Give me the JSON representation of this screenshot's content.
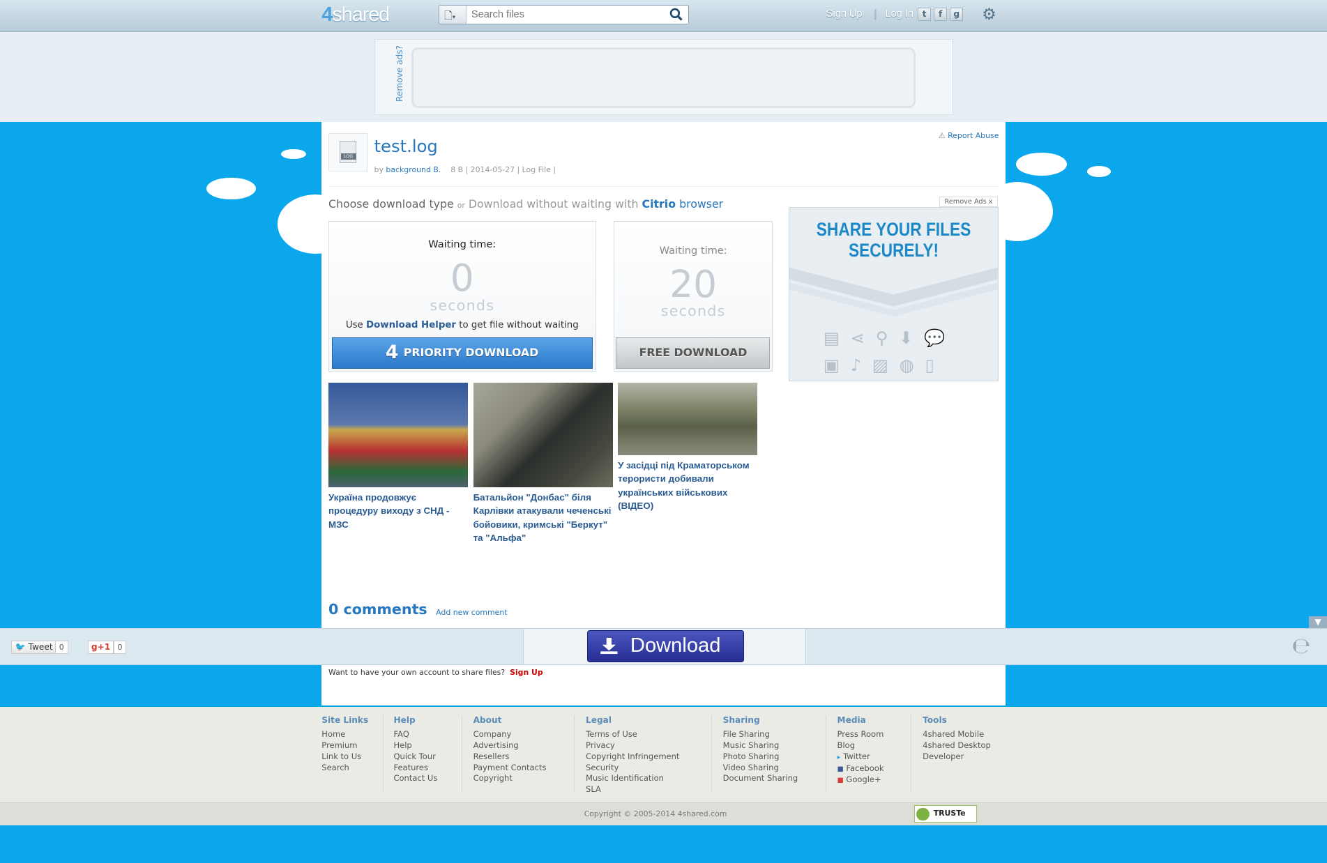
{
  "header": {
    "logo_num": "4",
    "logo_text": "shared",
    "search_placeholder": "Search files",
    "signup": "Sign Up",
    "login": "Log In"
  },
  "ad": {
    "remove_ads_vertical": "Remove ads?"
  },
  "file": {
    "title": "test.log",
    "icon_label": "LOG",
    "by": "by",
    "author": "background B.",
    "meta": "8 B | 2014-05-27 | Log File |",
    "report": "Report Abuse"
  },
  "choose": {
    "type": "Choose download type",
    "or": "or",
    "without": "Download without waiting with",
    "citrio": "Citrio",
    "browser": "browser"
  },
  "priority": {
    "waiting": "Waiting time:",
    "seconds_value": "0",
    "seconds": "seconds",
    "helper_pre": "Use",
    "helper_link": "Download Helper",
    "helper_post": "to get file without waiting",
    "button": "PRIORITY DOWNLOAD"
  },
  "free": {
    "waiting": "Waiting time:",
    "seconds_value": "20",
    "seconds": "seconds",
    "button": "FREE DOWNLOAD"
  },
  "side_ad": {
    "remove": "Remove Ads",
    "remove_x": "x",
    "headline1": "SHARE YOUR FILES",
    "headline2": "SECURELY!"
  },
  "news": [
    {
      "caption": "Україна продовжує процедуру виходу з СНД - МЗС"
    },
    {
      "caption": "Батальйон \"Донбас\" біля Карлівки атакували чеченські бойовики, кримські \"Беркут\" та \"Альфа\""
    },
    {
      "caption": "У засідці під Краматорськом терористи добивали українських військових (ВІДЕО)"
    }
  ],
  "comments": {
    "count_label": "0 comments",
    "add": "Add new comment"
  },
  "bottom": {
    "tweet": "Tweet",
    "tweet_count": "0",
    "gplus": "+1",
    "gplus_count": "0",
    "download": "Download"
  },
  "signup_line": {
    "text": "Want to have your own account to share files?",
    "link": "Sign Up"
  },
  "footer": {
    "columns": [
      {
        "title": "Site Links",
        "items": [
          "Home",
          "Premium",
          "Link to Us",
          "Search"
        ]
      },
      {
        "title": "Help",
        "items": [
          "FAQ",
          "Help",
          "Quick Tour",
          "Features",
          "Contact Us"
        ]
      },
      {
        "title": "About",
        "items": [
          "Company",
          "Advertising",
          "Resellers",
          "Payment Contacts",
          "Copyright"
        ]
      },
      {
        "title": "Legal",
        "items": [
          "Terms of Use",
          "Privacy",
          "Copyright Infringement",
          "Security",
          "Music Identification",
          "SLA"
        ]
      },
      {
        "title": "Sharing",
        "items": [
          "File Sharing",
          "Music Sharing",
          "Photo Sharing",
          "Video Sharing",
          "Document Sharing"
        ]
      },
      {
        "title": "Media",
        "items": [
          "Press Room",
          "Blog",
          "Twitter",
          "Facebook",
          "Google+"
        ]
      },
      {
        "title": "Tools",
        "items": [
          "4shared Mobile",
          "4shared Desktop",
          "Developer"
        ]
      }
    ],
    "copyright": "Copyright © 2005-2014 4shared.com",
    "truste": "TRUSTe"
  }
}
